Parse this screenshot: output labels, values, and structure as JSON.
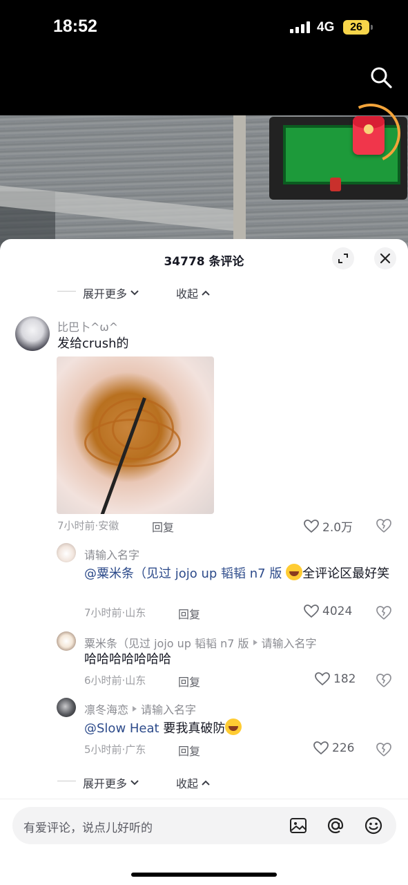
{
  "status_bar": {
    "time": "18:52",
    "network": "4G",
    "battery": "26"
  },
  "panel": {
    "title": "34778 条评论"
  },
  "expand_top": {
    "more": "展开更多",
    "collapse": "收起"
  },
  "expand_bottom": {
    "more": "展开更多",
    "collapse": "收起"
  },
  "comments": [
    {
      "user": "比巴卜^ω^",
      "text": "发给crush的",
      "time_location": "7小时前·安徽",
      "reply": "回复",
      "likes": "2.0万"
    }
  ],
  "replies": [
    {
      "user": "请输入名字",
      "mention": "@粟米条（见过 jojo up 韬韬 n7 版",
      "text_after": "全评论区最好笑",
      "time_location": "7小时前·山东",
      "reply": "回复",
      "likes": "4024"
    },
    {
      "user": "粟米条（见过 jojo up 韬韬 n7 版",
      "reply_to": "请输入名字",
      "text": "哈哈哈哈哈哈哈",
      "time_location": "6小时前·山东",
      "reply": "回复",
      "likes": "182"
    },
    {
      "user": "凛冬海恋",
      "reply_to": "请输入名字",
      "mention": "@Slow Heat",
      "text_after": " 要我真破防",
      "time_location": "5小时前·广东",
      "reply": "回复",
      "likes": "226"
    }
  ],
  "input": {
    "placeholder": "有爱评论，说点儿好听的"
  },
  "icons": [
    "search-icon",
    "red-packet-icon",
    "expand-icon",
    "close-icon",
    "heart-icon",
    "broken-heart-icon",
    "image-icon",
    "at-icon",
    "emoji-icon",
    "chevron-down-icon",
    "chevron-up-icon",
    "triangle-right-icon"
  ]
}
